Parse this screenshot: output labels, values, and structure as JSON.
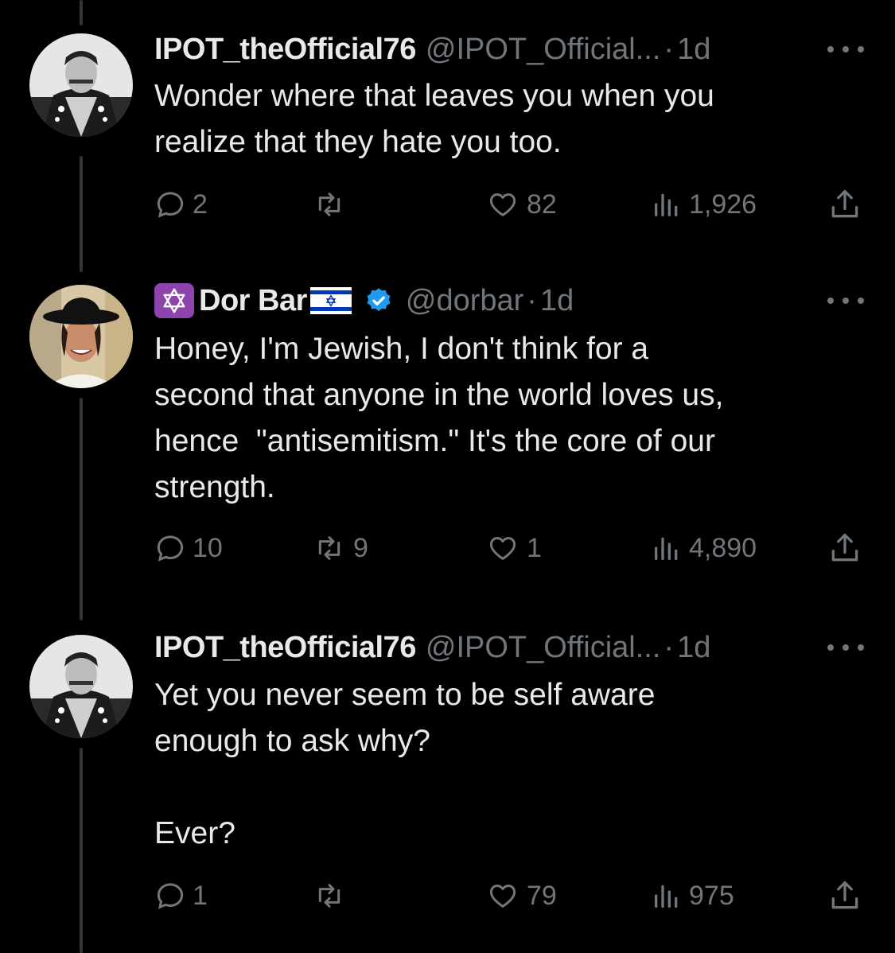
{
  "tweets": [
    {
      "name": "IPOT_theOfficial76",
      "handle": "@IPOT_Official...",
      "time": "1d",
      "text": "Wonder where that leaves you when you\nrealize that they hate you too.",
      "replies": "2",
      "reposts": "",
      "likes": "82",
      "views": "1,926"
    },
    {
      "name": "Dor Bar",
      "handle": "@dorbar",
      "time": "1d",
      "text": "Honey, I'm Jewish, I don't think for a\nsecond that anyone in the world loves us,\nhence  \"antisemitism.\" It's the core of our\nstrength.",
      "replies": "10",
      "reposts": "9",
      "likes": "1",
      "views": "4,890"
    },
    {
      "name": "IPOT_theOfficial76",
      "handle": "@IPOT_Official...",
      "time": "1d",
      "text": "Yet you never seem to be self aware\nenough to ask why?\n\nEver?",
      "replies": "1",
      "reposts": "",
      "likes": "79",
      "views": "975"
    }
  ],
  "separator": "·",
  "colors": {
    "background": "#000000",
    "text": "#e7e9ea",
    "secondary": "#71767b",
    "verified": "#1d9bf0",
    "badge": "#8e44ad",
    "flag_blue": "#0038b8"
  }
}
